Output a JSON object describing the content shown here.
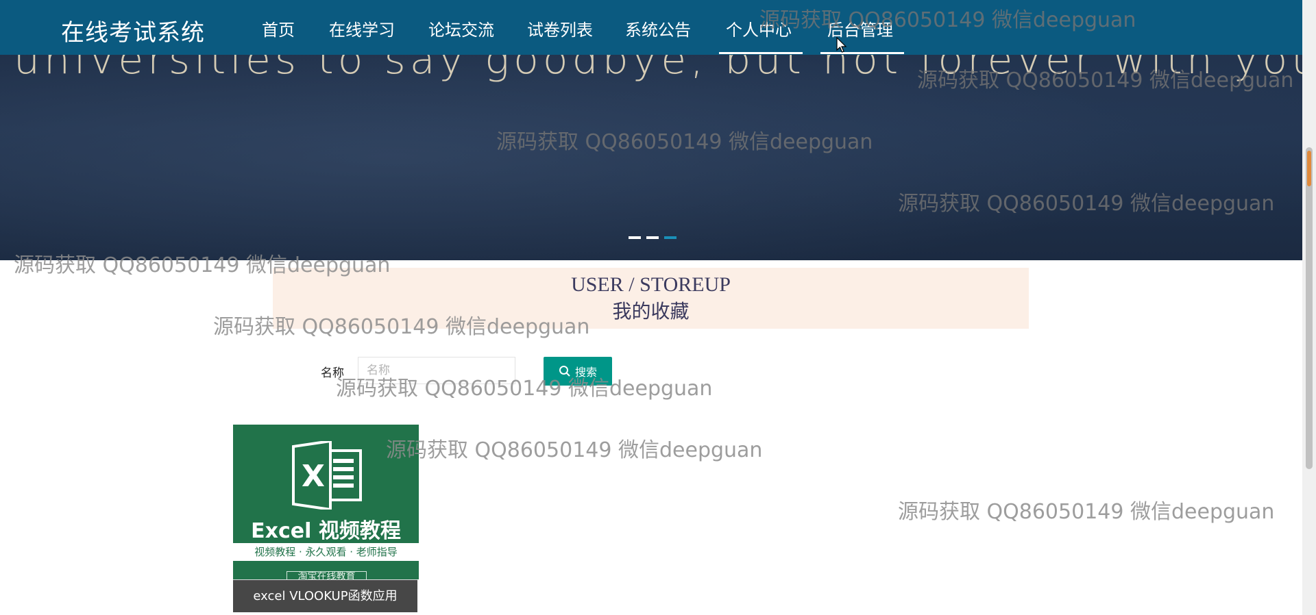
{
  "app": {
    "title": "在线考试系统"
  },
  "nav": {
    "items": [
      {
        "label": "首页"
      },
      {
        "label": "在线学习"
      },
      {
        "label": "论坛交流"
      },
      {
        "label": "试卷列表"
      },
      {
        "label": "系统公告"
      },
      {
        "label": "个人中心"
      },
      {
        "label": "后台管理"
      }
    ]
  },
  "banner": {
    "text": "universities to say goodbye, but not forever with you",
    "slides": 3,
    "active_slide": 3
  },
  "header": {
    "title_en": "USER / STOREUP",
    "title_cn": "我的收藏"
  },
  "search": {
    "label": "名称",
    "placeholder": "名称",
    "button_label": "搜索"
  },
  "items": [
    {
      "image_title": "Excel 视频教程",
      "image_subtitle": "视频教程 · 永久观看 · 老师指导",
      "image_badge": "淘宝在线教育",
      "caption": "excel VLOOKUP函数应用"
    }
  ],
  "watermark": {
    "text": "源码获取 QQ86050149 微信deepguan"
  },
  "colors": {
    "nav_bg": "#0b5a80",
    "search_button": "#009688",
    "header_strip": "#fcefe6",
    "card_green": "#21734a",
    "caption_bg": "#474747"
  }
}
